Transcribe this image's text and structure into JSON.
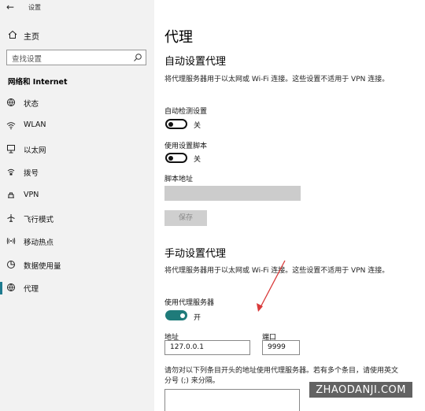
{
  "titlebar": {
    "title": "设置"
  },
  "sidebar": {
    "home_label": "主页",
    "search_placeholder": "查找设置",
    "section_title": "网络和 Internet",
    "items": [
      {
        "label": "状态",
        "icon": "globe-status-icon"
      },
      {
        "label": "WLAN",
        "icon": "wifi-icon"
      },
      {
        "label": "以太网",
        "icon": "ethernet-icon"
      },
      {
        "label": "拨号",
        "icon": "dialup-icon"
      },
      {
        "label": "VPN",
        "icon": "vpn-icon"
      },
      {
        "label": "飞行模式",
        "icon": "airplane-icon"
      },
      {
        "label": "移动热点",
        "icon": "hotspot-icon"
      },
      {
        "label": "数据使用量",
        "icon": "data-usage-icon"
      },
      {
        "label": "代理",
        "icon": "globe-icon",
        "active": true
      }
    ]
  },
  "main": {
    "title": "代理",
    "auto": {
      "heading": "自动设置代理",
      "description": "将代理服务器用于以太网或 Wi-Fi 连接。这些设置不适用于 VPN 连接。",
      "detect_label": "自动检测设置",
      "detect_state": "关",
      "script_label": "使用设置脚本",
      "script_state": "关",
      "address_label": "脚本地址",
      "save_label": "保存"
    },
    "manual": {
      "heading": "手动设置代理",
      "description": "将代理服务器用于以太网或 Wi-Fi 连接。这些设置不适用于 VPN 连接。",
      "use_proxy_label": "使用代理服务器",
      "use_proxy_state": "开",
      "address_label": "地址",
      "address_value": "127.0.0.1",
      "port_label": "端口",
      "port_value": "9999",
      "exceptions_text": "请勿对以下列条目开头的地址使用代理服务器。若有多个条目，请使用英文分号 (;) 来分隔。"
    }
  },
  "watermark": "ZHAODANJI.COM",
  "colors": {
    "accent": "#1f7b7a",
    "sidebar_bg": "#f2f2f2",
    "arrow": "#d93a3a"
  }
}
